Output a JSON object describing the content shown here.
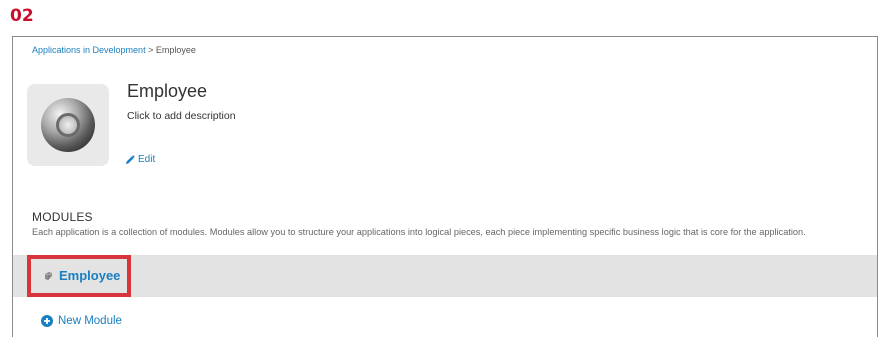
{
  "step_number": "02",
  "breadcrumb": {
    "parent": "Applications in Development",
    "separator": " > ",
    "current": "Employee"
  },
  "application": {
    "title": "Employee",
    "description_placeholder": "Click to add description",
    "edit_label": "Edit",
    "icon": "disc-icon"
  },
  "modules": {
    "heading": "MODULES",
    "description": "Each application is a collection of modules. Modules allow you to structure your applications into logical pieces, each piece implementing specific business logic that is core for the application.",
    "items": [
      {
        "label": "Employee",
        "icon": "module-icon"
      }
    ],
    "new_module_label": "New Module",
    "new_module_icon": "plus-circle-icon"
  },
  "colors": {
    "link": "#1a7fc0",
    "highlight": "#d8343c",
    "step_number": "#c8102e"
  }
}
